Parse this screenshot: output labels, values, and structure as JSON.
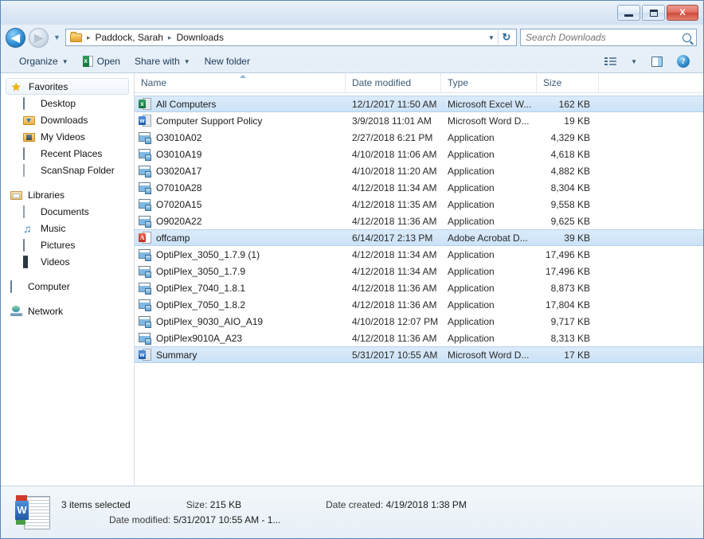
{
  "window": {
    "minimize_label": "Minimize",
    "maximize_label": "Maximize",
    "close_label": "X"
  },
  "address": {
    "back_label": "◀",
    "forward_label": "▶",
    "history_caret": "▼",
    "folder_icon": "folder-icon",
    "breadcrumbs": [
      "Paddock, Sarah",
      "Downloads"
    ],
    "separator": "▸",
    "dropdown_caret": "▼",
    "refresh_label": "↻"
  },
  "search": {
    "placeholder": "Search Downloads",
    "value": ""
  },
  "toolbar": {
    "organize_label": "Organize",
    "open_label": "Open",
    "share_label": "Share with",
    "newfolder_label": "New folder",
    "caret": "▼",
    "help_label": "?"
  },
  "sidebar": {
    "groups": [
      {
        "header": {
          "label": "Favorites",
          "icon": "star-icon",
          "selected": true
        },
        "items": [
          {
            "label": "Desktop",
            "icon": "desktop-icon"
          },
          {
            "label": "Downloads",
            "icon": "downloads-folder-icon"
          },
          {
            "label": "My Videos",
            "icon": "videos-folder-icon"
          },
          {
            "label": "Recent Places",
            "icon": "recent-places-icon"
          },
          {
            "label": "ScanSnap Folder",
            "icon": "document-icon"
          }
        ]
      },
      {
        "header": {
          "label": "Libraries",
          "icon": "libraries-icon",
          "selected": false
        },
        "items": [
          {
            "label": "Documents",
            "icon": "documents-icon"
          },
          {
            "label": "Music",
            "icon": "music-icon"
          },
          {
            "label": "Pictures",
            "icon": "pictures-icon"
          },
          {
            "label": "Videos",
            "icon": "video-icon"
          }
        ]
      },
      {
        "header": {
          "label": "Computer",
          "icon": "computer-icon",
          "selected": false
        },
        "items": []
      },
      {
        "header": {
          "label": "Network",
          "icon": "network-icon",
          "selected": false
        },
        "items": []
      }
    ]
  },
  "filelist": {
    "columns": [
      {
        "key": "name",
        "label": "Name"
      },
      {
        "key": "date",
        "label": "Date modified"
      },
      {
        "key": "type",
        "label": "Type"
      },
      {
        "key": "size",
        "label": "Size"
      }
    ],
    "sort_column": "Name",
    "sort_direction": "ascending",
    "rows": [
      {
        "name": "All Computers",
        "date": "12/1/2017 11:50 AM",
        "type": "Microsoft Excel W...",
        "size": "162 KB",
        "icon": "excel-file-icon",
        "selected": true
      },
      {
        "name": "Computer Support Policy",
        "date": "3/9/2018 11:01 AM",
        "type": "Microsoft Word D...",
        "size": "19 KB",
        "icon": "word-file-icon",
        "selected": false
      },
      {
        "name": "O3010A02",
        "date": "2/27/2018 6:21 PM",
        "type": "Application",
        "size": "4,329 KB",
        "icon": "application-icon",
        "selected": false
      },
      {
        "name": "O3010A19",
        "date": "4/10/2018 11:06 AM",
        "type": "Application",
        "size": "4,618 KB",
        "icon": "application-icon",
        "selected": false
      },
      {
        "name": "O3020A17",
        "date": "4/10/2018 11:20 AM",
        "type": "Application",
        "size": "4,882 KB",
        "icon": "application-icon",
        "selected": false
      },
      {
        "name": "O7010A28",
        "date": "4/12/2018 11:34 AM",
        "type": "Application",
        "size": "8,304 KB",
        "icon": "application-icon",
        "selected": false
      },
      {
        "name": "O7020A15",
        "date": "4/12/2018 11:35 AM",
        "type": "Application",
        "size": "9,558 KB",
        "icon": "application-icon",
        "selected": false
      },
      {
        "name": "O9020A22",
        "date": "4/12/2018 11:36 AM",
        "type": "Application",
        "size": "9,625 KB",
        "icon": "application-icon",
        "selected": false
      },
      {
        "name": "offcamp",
        "date": "6/14/2017 2:13 PM",
        "type": "Adobe Acrobat D...",
        "size": "39 KB",
        "icon": "pdf-file-icon",
        "selected": true
      },
      {
        "name": "OptiPlex_3050_1.7.9 (1)",
        "date": "4/12/2018 11:34 AM",
        "type": "Application",
        "size": "17,496 KB",
        "icon": "application-icon",
        "selected": false
      },
      {
        "name": "OptiPlex_3050_1.7.9",
        "date": "4/12/2018 11:34 AM",
        "type": "Application",
        "size": "17,496 KB",
        "icon": "application-icon",
        "selected": false
      },
      {
        "name": "OptiPlex_7040_1.8.1",
        "date": "4/12/2018 11:36 AM",
        "type": "Application",
        "size": "8,873 KB",
        "icon": "application-icon",
        "selected": false
      },
      {
        "name": "OptiPlex_7050_1.8.2",
        "date": "4/12/2018 11:36 AM",
        "type": "Application",
        "size": "17,804 KB",
        "icon": "application-icon",
        "selected": false
      },
      {
        "name": "OptiPlex_9030_AIO_A19",
        "date": "4/10/2018 12:07 PM",
        "type": "Application",
        "size": "9,717 KB",
        "icon": "application-icon",
        "selected": false
      },
      {
        "name": "OptiPlex9010A_A23",
        "date": "4/12/2018 11:36 AM",
        "type": "Application",
        "size": "8,313 KB",
        "icon": "application-icon",
        "selected": false
      },
      {
        "name": "Summary",
        "date": "5/31/2017 10:55 AM",
        "type": "Microsoft Word D...",
        "size": "17 KB",
        "icon": "word-file-icon",
        "selected": true
      }
    ]
  },
  "statusbar": {
    "icon": "word-document-icon",
    "selection_text": "3 items selected",
    "size_label": "Size:",
    "size_value": "215 KB",
    "created_label": "Date created:",
    "created_value": "4/19/2018 1:38 PM",
    "modified_label": "Date modified:",
    "modified_value": "5/31/2017 10:55 AM - 1..."
  },
  "colors": {
    "selection": "#cbe2f7",
    "window_border": "#5a87b8",
    "close_button": "#cc4a38"
  }
}
